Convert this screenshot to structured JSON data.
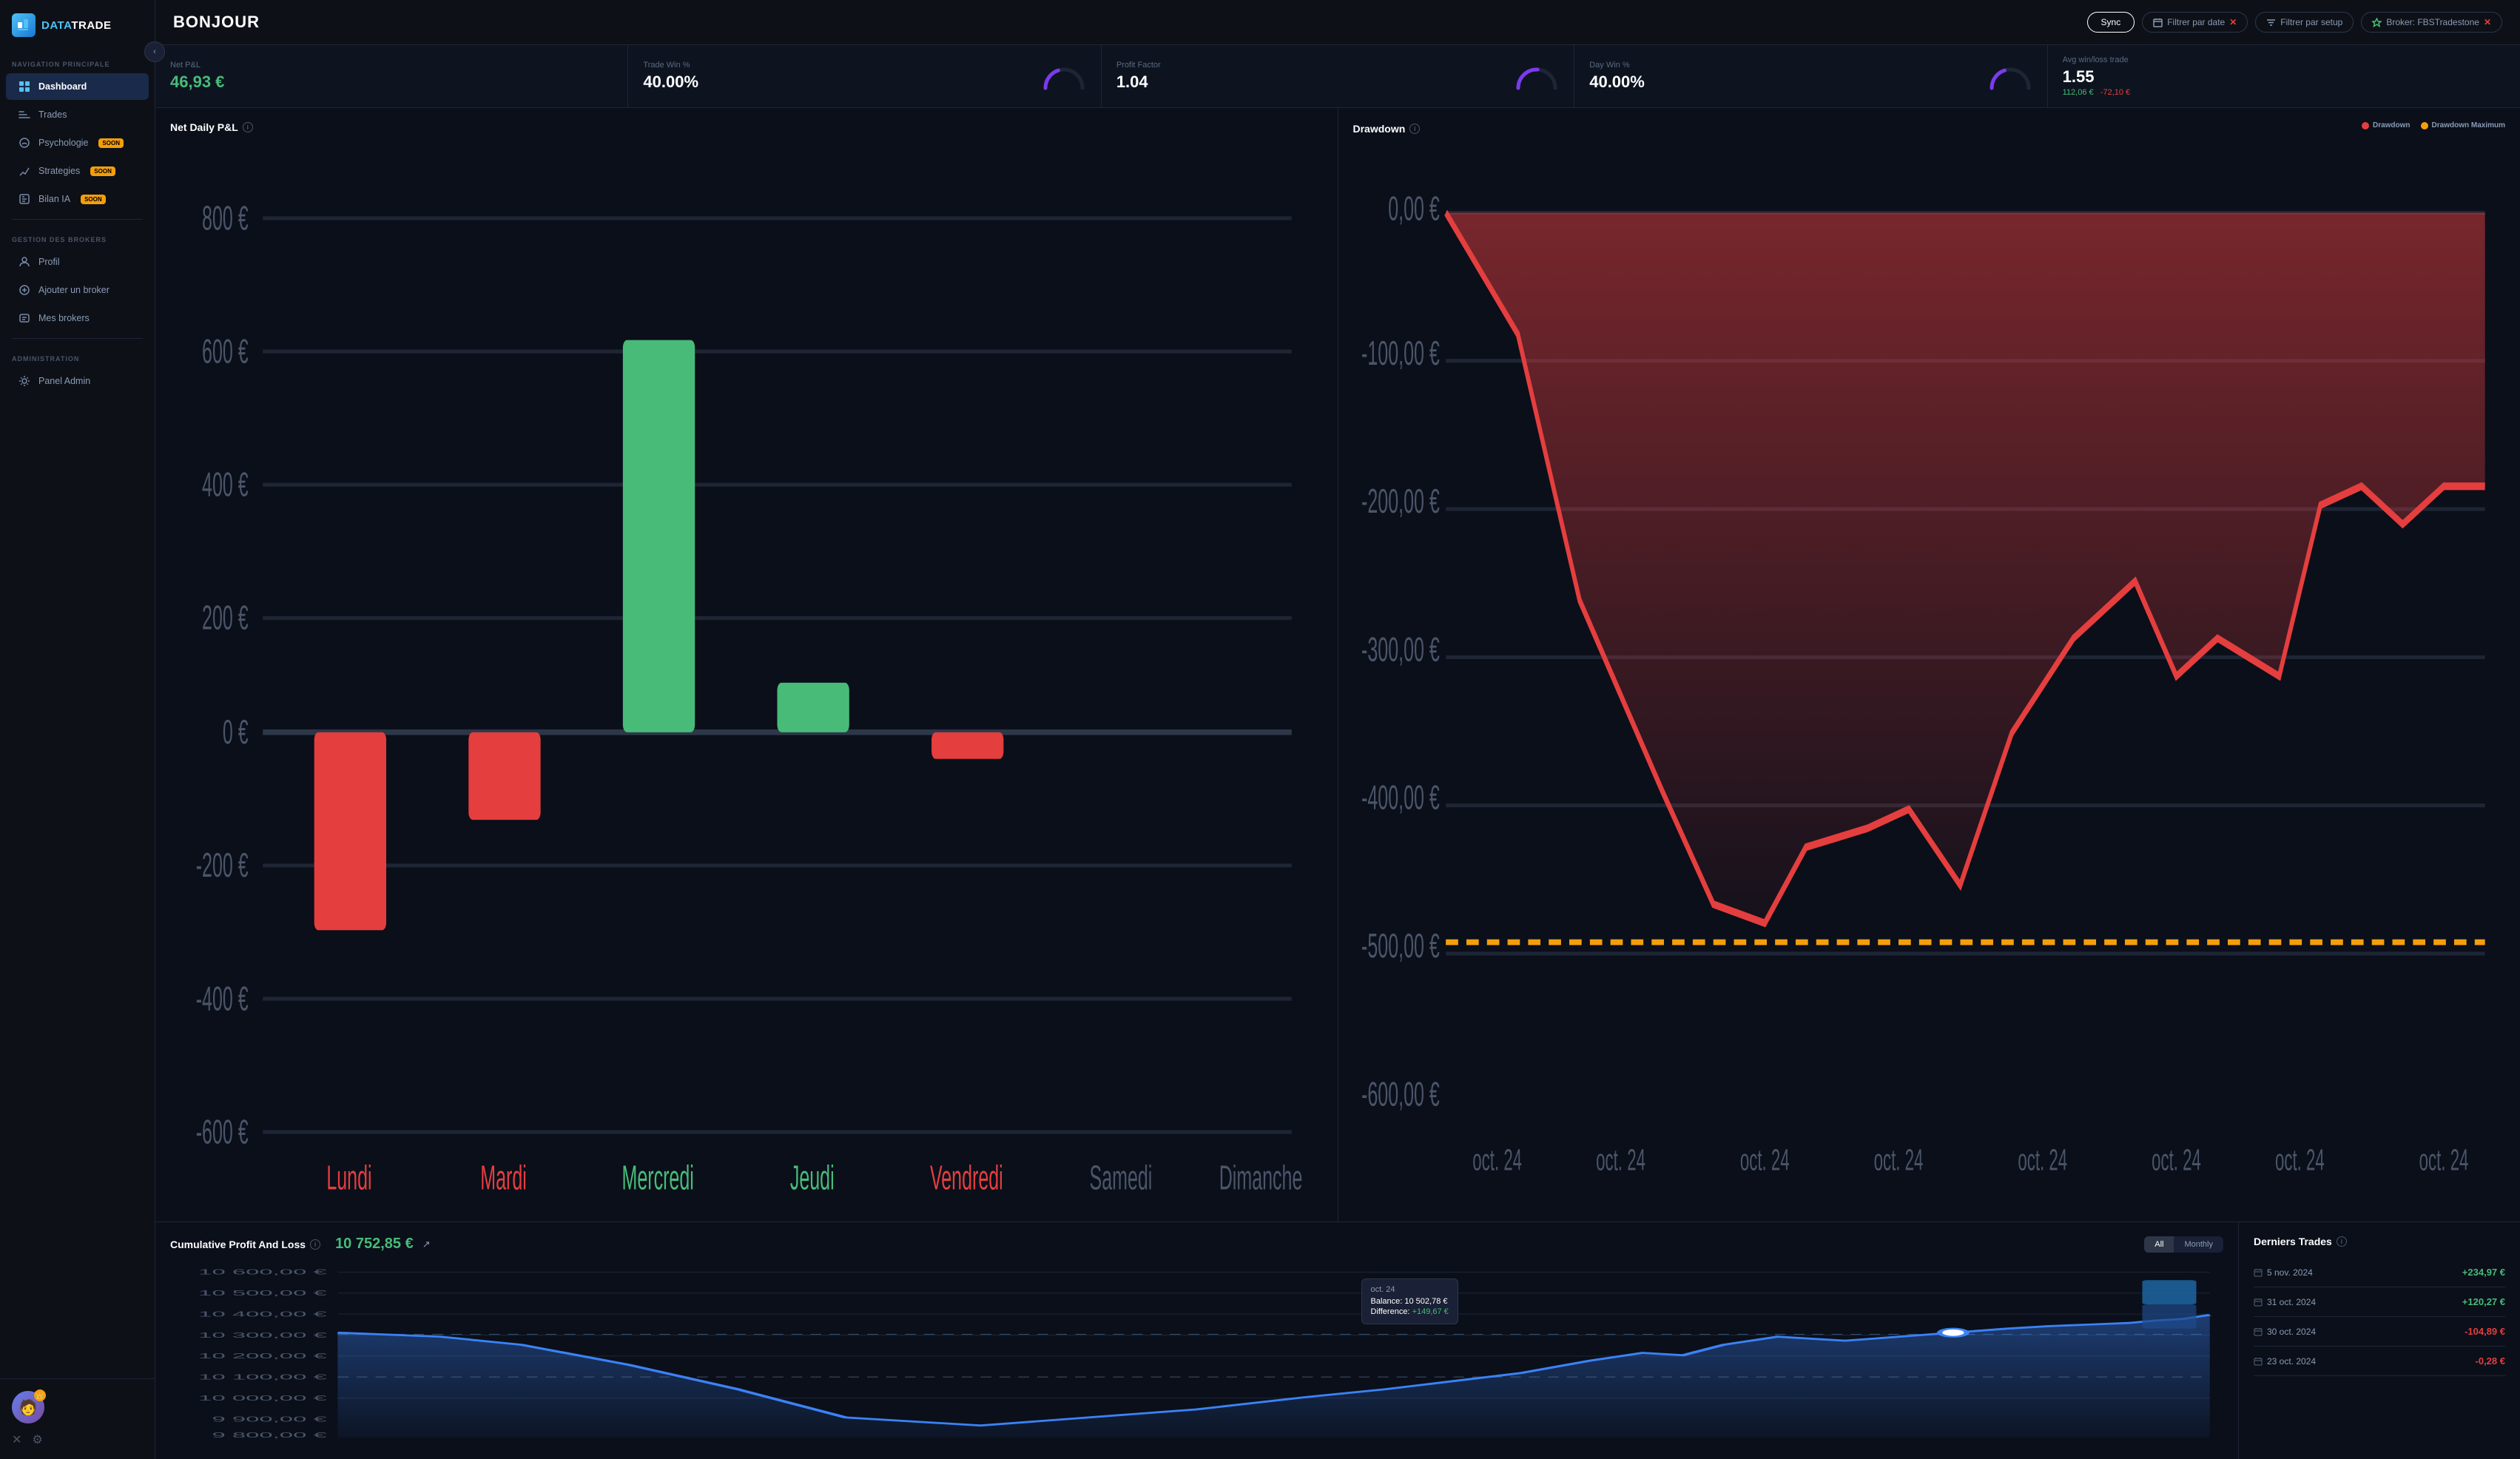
{
  "app": {
    "logo_text_1": "DATA",
    "logo_text_2": "TRADE"
  },
  "sidebar": {
    "nav_label": "NAVIGATION PRINCIPALE",
    "nav_items": [
      {
        "id": "dashboard",
        "label": "Dashboard",
        "active": true,
        "soon": false
      },
      {
        "id": "trades",
        "label": "Trades",
        "active": false,
        "soon": false
      },
      {
        "id": "psychologie",
        "label": "Psychologie",
        "active": false,
        "soon": true
      },
      {
        "id": "strategies",
        "label": "Strategies",
        "active": false,
        "soon": true
      },
      {
        "id": "bilan-ia",
        "label": "Bilan IA",
        "active": false,
        "soon": true
      }
    ],
    "broker_label": "GESTION DES BROKERS",
    "broker_items": [
      {
        "id": "profil",
        "label": "Profil"
      },
      {
        "id": "ajouter",
        "label": "Ajouter un broker"
      },
      {
        "id": "mes-brokers",
        "label": "Mes brokers"
      }
    ],
    "admin_label": "ADMINISTRATION",
    "admin_items": [
      {
        "id": "panel-admin",
        "label": "Panel Admin"
      }
    ],
    "soon_badge": "SOON"
  },
  "header": {
    "title": "BONJOUR",
    "sync_label": "Sync",
    "filter_date_label": "Filtrer par date",
    "filter_setup_label": "Filtrer par setup",
    "broker_label": "Broker: FBSTradestone"
  },
  "stats": [
    {
      "id": "net-pnl",
      "label": "Net P&L",
      "value": "46,93 €",
      "color": "green",
      "gauge": false
    },
    {
      "id": "trade-win",
      "label": "Trade Win %",
      "value": "40.00%",
      "color": "white",
      "gauge": true,
      "gauge_pct": 40
    },
    {
      "id": "profit-factor",
      "label": "Profit Factor",
      "value": "1.04",
      "color": "white",
      "gauge": true,
      "gauge_pct": 52
    },
    {
      "id": "day-win",
      "label": "Day Win %",
      "value": "40.00%",
      "color": "white",
      "gauge": true,
      "gauge_pct": 40
    },
    {
      "id": "avg-win-loss",
      "label": "Avg win/loss trade",
      "value": "1.55",
      "color": "white",
      "gauge": false,
      "sub_green": "112,06 €",
      "sub_red": "-72,10 €"
    }
  ],
  "net_daily_pnl": {
    "title": "Net Daily P&L",
    "bars": [
      {
        "label": "Lundi",
        "value": -300,
        "color": "red"
      },
      {
        "label": "Mardi",
        "value": -130,
        "color": "red"
      },
      {
        "label": "Mercredi",
        "value": 590,
        "color": "green"
      },
      {
        "label": "Jeudi",
        "value": 75,
        "color": "green"
      },
      {
        "label": "Vendredi",
        "value": -40,
        "color": "red"
      },
      {
        "label": "Samedi",
        "value": 0,
        "color": "gray"
      },
      {
        "label": "Dimanche",
        "value": 0,
        "color": "gray"
      }
    ],
    "y_labels": [
      "800 €",
      "600 €",
      "400 €",
      "200 €",
      "0 €",
      "-200 €",
      "-400 €",
      "-600 €"
    ]
  },
  "drawdown": {
    "title": "Drawdown",
    "legend_drawdown": "Drawdown",
    "legend_max": "Drawdown Maximum",
    "x_labels": [
      "oct. 24",
      "oct. 24",
      "oct. 24",
      "oct. 24",
      "oct. 24",
      "oct. 24",
      "oct. 24",
      "oct. 24"
    ],
    "y_labels": [
      "0,00 €",
      "-100,00 €",
      "-200,00 €",
      "-300,00 €",
      "-400,00 €",
      "-500,00 €",
      "-600,00 €"
    ]
  },
  "cumulative": {
    "title": "Cumulative Profit And Loss",
    "value": "10 752,85 €",
    "toggle_all": "All",
    "toggle_monthly": "Monthly",
    "active_toggle": "all",
    "tooltip": {
      "title": "oct. 24",
      "balance_label": "Balance:",
      "balance_value": "10 502,78 €",
      "diff_label": "Difference:",
      "diff_value": "+149,67 €"
    },
    "y_labels": [
      "10 600,00 €",
      "10 500,00 €",
      "10 400,00 €",
      "10 300,00 €",
      "10 200,00 €",
      "10 100,00 €",
      "10 000,00 €",
      "9 900,00 €",
      "9 800,00 €"
    ]
  },
  "derniers_trades": {
    "title": "Derniers Trades",
    "trades": [
      {
        "date": "5 nov. 2024",
        "amount": "+234,97 €",
        "positive": true
      },
      {
        "date": "31 oct. 2024",
        "amount": "+120,27 €",
        "positive": true
      },
      {
        "date": "30 oct. 2024",
        "amount": "-104,89 €",
        "positive": false
      },
      {
        "date": "23 oct. 2024",
        "amount": "-0,28 €",
        "positive": false
      }
    ]
  }
}
